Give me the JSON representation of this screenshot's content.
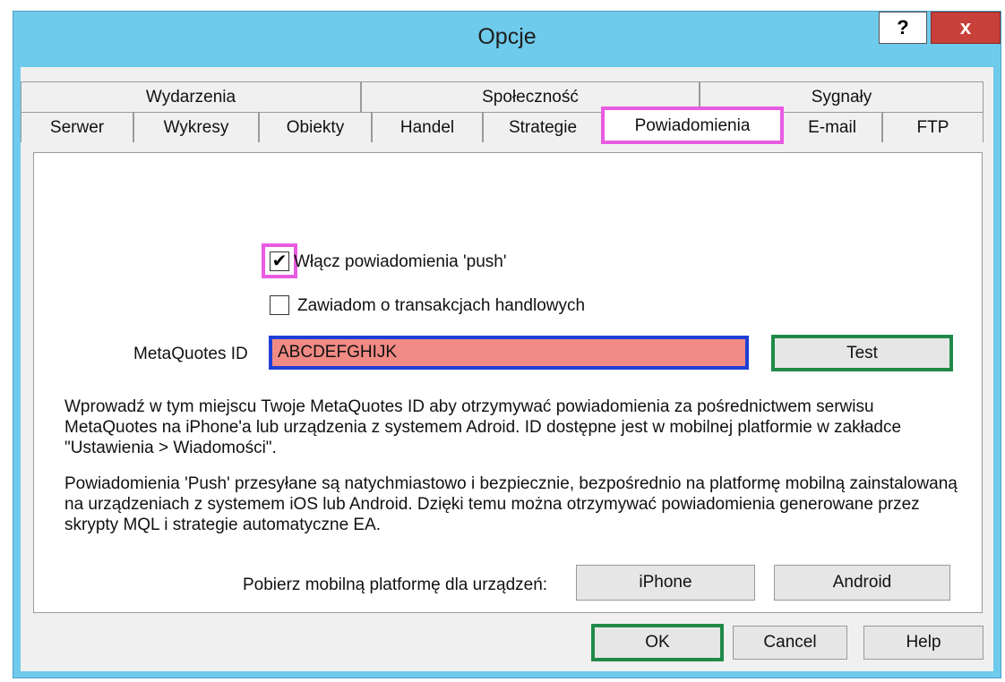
{
  "window": {
    "title": "Opcje",
    "help_glyph": "?",
    "close_glyph": "x"
  },
  "tabs": {
    "row1": [
      "Wydarzenia",
      "Społeczność",
      "Sygnały"
    ],
    "row2": [
      "Serwer",
      "Wykresy",
      "Obiekty",
      "Handel",
      "Strategie",
      "Powiadomienia",
      "E-mail",
      "FTP"
    ],
    "active": "Powiadomienia"
  },
  "notifications": {
    "enable_push": {
      "label": "Włącz powiadomienia 'push'",
      "checked": true,
      "check_glyph": "✔"
    },
    "trade_notify": {
      "label": "Zawiadom o transakcjach handlowych",
      "checked": false
    },
    "metaquotes_id": {
      "label": "MetaQuotes ID",
      "value": "ABCDEFGHIJK"
    },
    "test_button": "Test",
    "info_1": "Wprowadź w tym miejscu Twoje MetaQuotes ID aby otrzymywać powiadomienia za pośrednictwem serwisu MetaQuotes na iPhone'a lub urządzenia z systemem Adroid. ID dostępne jest w mobilnej platformie w zakładce \"Ustawienia > Wiadomości\".",
    "info_2": "Powiadomienia 'Push' przesyłane są natychmiastowo i bezpiecznie, bezpośrednio na platformę mobilną zainstalowaną na urządzeniach z systemem iOS lub Android. Dzięki temu można otrzymywać powiadomienia generowane przez skrypty MQL i strategie automatyczne EA.",
    "download_label": "Pobierz mobilną platformę dla urządzeń:",
    "iphone_button": "iPhone",
    "android_button": "Android"
  },
  "footer": {
    "ok": "OK",
    "cancel": "Cancel",
    "help": "Help"
  },
  "colors": {
    "title_bar": "#6fcbec",
    "highlight_pink": "#e85be2",
    "highlight_blue": "#1e3fd6",
    "highlight_green": "#1f8a48",
    "input_bg": "#f08a84"
  }
}
